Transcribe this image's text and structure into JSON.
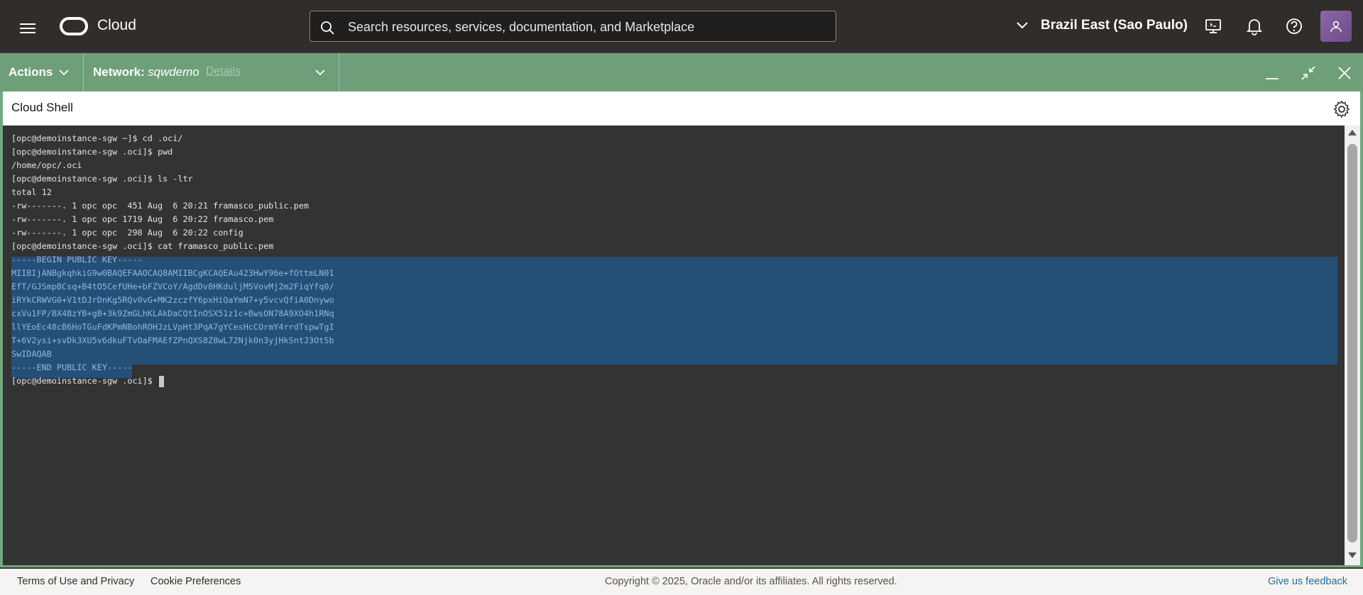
{
  "header": {
    "brand": "Cloud",
    "search_placeholder": "Search resources, services, documentation, and Marketplace",
    "region": "Brazil East (Sao Paulo)",
    "icons": [
      "menu-icon",
      "oracle-logo",
      "search-icon",
      "chevron-down-icon",
      "developer-tools-icon",
      "bell-icon",
      "help-icon",
      "user-icon"
    ]
  },
  "shell_bar": {
    "actions_label": "Actions",
    "network_label": "Network:",
    "network_name": "sqwdemo",
    "details_label": "Details"
  },
  "shell": {
    "title": "Cloud Shell"
  },
  "terminal": {
    "lines": [
      "[opc@demoinstance-sgw ~]$ cd .oci/",
      "[opc@demoinstance-sgw .oci]$ pwd",
      "/home/opc/.oci",
      "[opc@demoinstance-sgw .oci]$ ls -ltr",
      "total 12",
      "-rw-------. 1 opc opc  451 Aug  6 20:21 framasco_public.pem",
      "-rw-------. 1 opc opc 1719 Aug  6 20:22 framasco.pem",
      "-rw-------. 1 opc opc  298 Aug  6 20:22 config",
      "[opc@demoinstance-sgw .oci]$ cat framasco_public.pem"
    ],
    "selected_lines": [
      "-----BEGIN PUBLIC KEY-----",
      "MIIBIjANBgkqhkiG9w0BAQEFAAOCAQ8AMIIBCgKCAQEAu423HwY96e+fOttmLN01",
      "EfT/GJSmpBCsq+B4tO5CefUHe+bFZVCoY/AgdDv8HKduljMSVovMj2m2FiqYfq0/",
      "iRYkCRWVG0+V1tDJrDnKg5RQv0vG+MK2zczfY6pxHiQaYmN7+y5vcvQfiA0Dnywo",
      "cxVu1FP/BX4BzYB+gB+3k9ZmGLhKLAkDaCQtInOSX51z1c+BwsON78A9XO4h1RNq",
      "llYEoEc48cB6HoTGuFdKPmNBohROHJzLVpHt3PqA7gYCesHcCOrmY4rrdTspwTgI",
      "T+6V2ysi+svDk3XU5v6dkuFTvOaFMAEfZPnQXS8Z8wL72Njk0n3yjHkSntJ3OtSb",
      "SwIDAQAB",
      "-----END PUBLIC KEY-----"
    ],
    "prompt": "[opc@demoinstance-sgw .oci]$ "
  },
  "footer": {
    "terms": "Terms of Use and Privacy",
    "cookies": "Cookie Preferences",
    "copyright": "Copyright © 2025, Oracle and/or its affiliates. All rights reserved.",
    "feedback": "Give us feedback"
  },
  "colors": {
    "header_bg": "#312d2a",
    "shell_green": "#6f9f79",
    "terminal_bg": "#333333",
    "selection": "#264f78"
  }
}
